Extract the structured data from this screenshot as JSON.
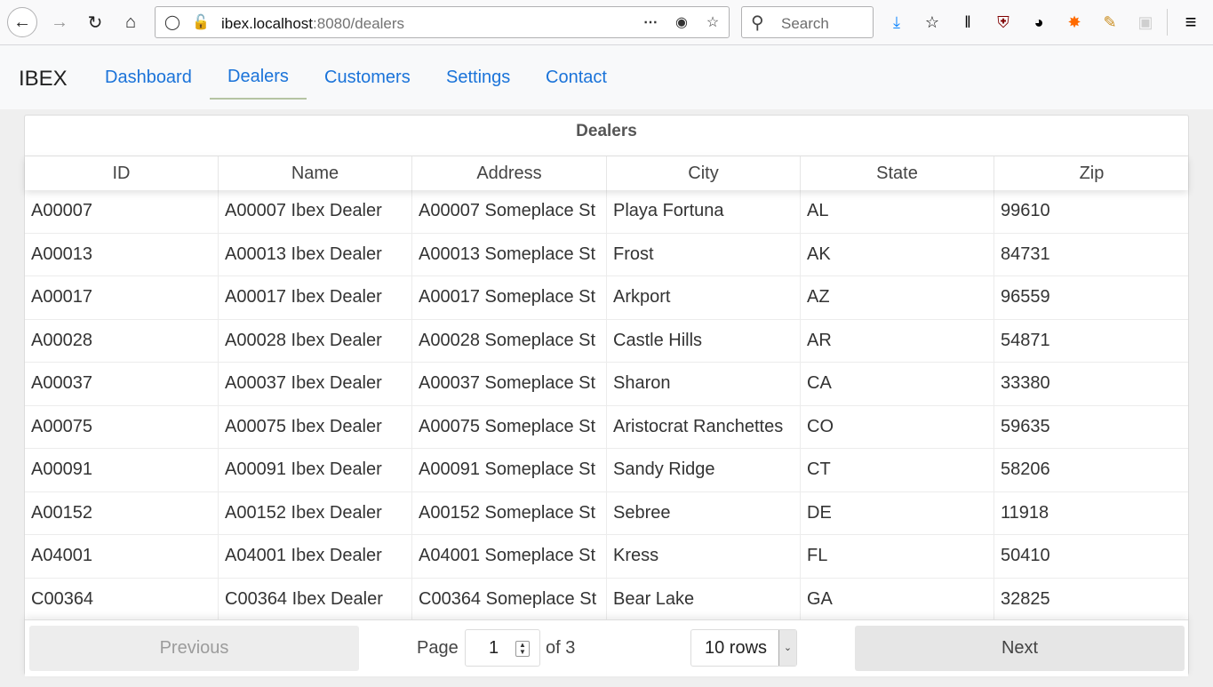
{
  "browser": {
    "url_host": "ibex.localhost",
    "url_rest": ":8080/dealers",
    "search_placeholder": "Search"
  },
  "app": {
    "brand": "IBEX",
    "nav": [
      {
        "label": "Dashboard"
      },
      {
        "label": "Dealers",
        "active": true
      },
      {
        "label": "Customers"
      },
      {
        "label": "Settings"
      },
      {
        "label": "Contact"
      }
    ]
  },
  "table": {
    "title": "Dealers",
    "columns": [
      "ID",
      "Name",
      "Address",
      "City",
      "State",
      "Zip"
    ],
    "rows": [
      [
        "A00007",
        "A00007 Ibex Dealer",
        "A00007 Someplace St",
        "Playa Fortuna",
        "AL",
        "99610"
      ],
      [
        "A00013",
        "A00013 Ibex Dealer",
        "A00013 Someplace St",
        "Frost",
        "AK",
        "84731"
      ],
      [
        "A00017",
        "A00017 Ibex Dealer",
        "A00017 Someplace St",
        "Arkport",
        "AZ",
        "96559"
      ],
      [
        "A00028",
        "A00028 Ibex Dealer",
        "A00028 Someplace St",
        "Castle Hills",
        "AR",
        "54871"
      ],
      [
        "A00037",
        "A00037 Ibex Dealer",
        "A00037 Someplace St",
        "Sharon",
        "CA",
        "33380"
      ],
      [
        "A00075",
        "A00075 Ibex Dealer",
        "A00075 Someplace St",
        "Aristocrat Ranchettes",
        "CO",
        "59635"
      ],
      [
        "A00091",
        "A00091 Ibex Dealer",
        "A00091 Someplace St",
        "Sandy Ridge",
        "CT",
        "58206"
      ],
      [
        "A00152",
        "A00152 Ibex Dealer",
        "A00152 Someplace St",
        "Sebree",
        "DE",
        "11918"
      ],
      [
        "A04001",
        "A04001 Ibex Dealer",
        "A04001 Someplace St",
        "Kress",
        "FL",
        "50410"
      ],
      [
        "C00364",
        "C00364 Ibex Dealer",
        "C00364 Someplace St",
        "Bear Lake",
        "GA",
        "32825"
      ]
    ]
  },
  "pager": {
    "previous": "Previous",
    "next": "Next",
    "page_label": "Page",
    "page_value": "1",
    "of_label": "of 3",
    "rows_value": "10 rows"
  },
  "colors": {
    "link": "#1a73d9",
    "active_underline": "#b5c4a3"
  }
}
